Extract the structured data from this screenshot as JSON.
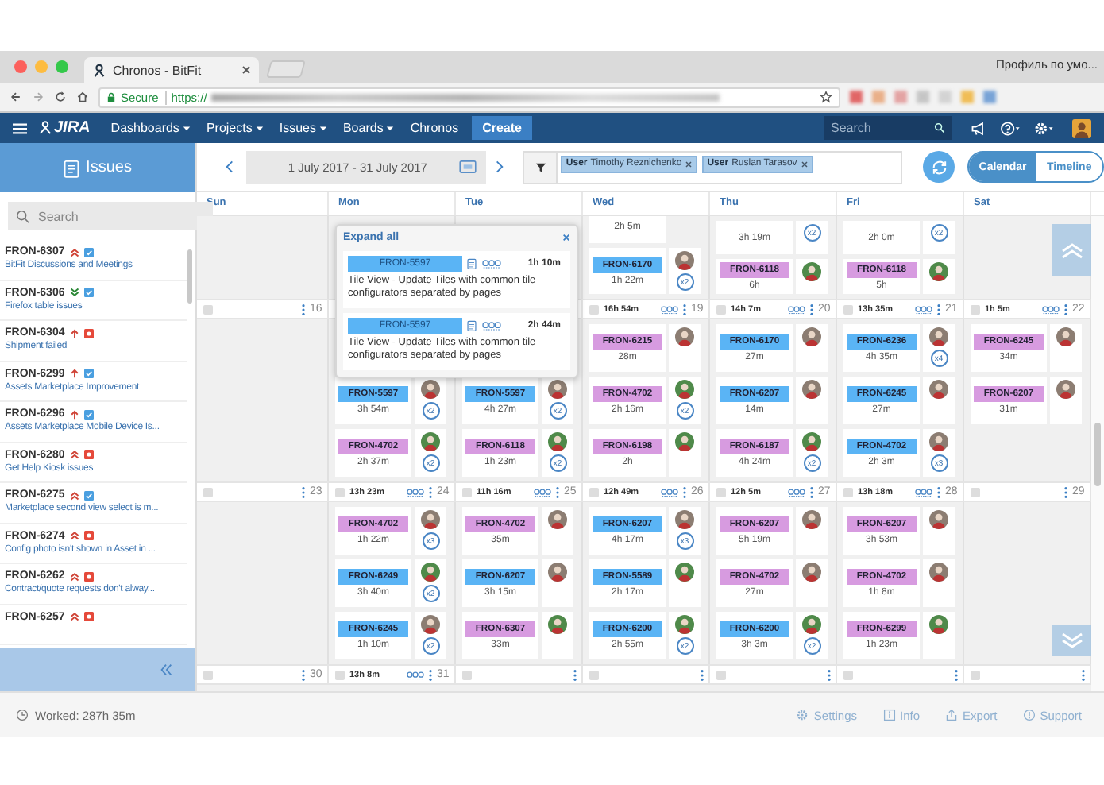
{
  "browser": {
    "tab_title": "Chronos - BitFit",
    "profile": "Профиль по умо...",
    "secure_label": "Secure",
    "url_scheme": "https://"
  },
  "nav": {
    "logo": "JIRA",
    "menu": [
      {
        "label": "Dashboards",
        "dropdown": true
      },
      {
        "label": "Projects",
        "dropdown": true
      },
      {
        "label": "Issues",
        "dropdown": true
      },
      {
        "label": "Boards",
        "dropdown": true
      },
      {
        "label": "Chronos",
        "dropdown": false
      }
    ],
    "create": "Create",
    "search": {
      "placeholder": "Search"
    }
  },
  "sidebar": {
    "title": "Issues",
    "search": {
      "placeholder": "Search"
    },
    "issues": [
      {
        "key": "FRON-6307",
        "icons": [
          {
            "kind": "highest"
          },
          {
            "kind": "task"
          }
        ],
        "title": "BitFit Discussions and Meetings"
      },
      {
        "key": "FRON-6306",
        "icons": [
          {
            "kind": "lowest"
          },
          {
            "kind": "task"
          }
        ],
        "title": "Firefox table issues"
      },
      {
        "key": "FRON-6304",
        "icons": [
          {
            "kind": "high"
          },
          {
            "kind": "bug"
          }
        ],
        "title": "Shipment failed"
      },
      {
        "key": "FRON-6299",
        "icons": [
          {
            "kind": "high"
          },
          {
            "kind": "task"
          }
        ],
        "title": "Assets Marketplace Improvement"
      },
      {
        "key": "FRON-6296",
        "icons": [
          {
            "kind": "high"
          },
          {
            "kind": "task"
          }
        ],
        "title": "Assets Marketplace Mobile Device Is..."
      },
      {
        "key": "FRON-6280",
        "icons": [
          {
            "kind": "highest"
          },
          {
            "kind": "bug"
          }
        ],
        "title": "Get Help Kiosk issues"
      },
      {
        "key": "FRON-6275",
        "icons": [
          {
            "kind": "highest"
          },
          {
            "kind": "task"
          }
        ],
        "title": "Marketplace second view select is m..."
      },
      {
        "key": "FRON-6274",
        "icons": [
          {
            "kind": "highest"
          },
          {
            "kind": "bug"
          }
        ],
        "title": "Config photo isn't shown in Asset in ..."
      },
      {
        "key": "FRON-6262",
        "icons": [
          {
            "kind": "highest"
          },
          {
            "kind": "bug"
          }
        ],
        "title": "Contract/quote requests don't alway..."
      },
      {
        "key": "FRON-6257",
        "icons": [
          {
            "kind": "highest"
          },
          {
            "kind": "bug"
          }
        ]
      }
    ]
  },
  "toolbar": {
    "range": "1 July 2017 - 31 July 2017",
    "filters": [
      {
        "label": "User",
        "value": "Timothy Reznichenko"
      },
      {
        "label": "User",
        "value": "Ruslan Tarasov"
      }
    ],
    "views": [
      {
        "label": "Calendar",
        "selected": true
      },
      {
        "label": "Timeline",
        "selected": false
      }
    ]
  },
  "weekdays": [
    "Sun",
    "Mon",
    "Tue",
    "Wed",
    "Thu",
    "Fri",
    "Sat"
  ],
  "rows": [
    {
      "kind": "partial",
      "cells": [
        {},
        {},
        {},
        {
          "cards": [
            {
              "duration": "2h 5m"
            },
            {
              "ticket": "FRON-6170",
              "color": "#5ab4f5",
              "duration": "1h 22m",
              "badge": "x2",
              "avatar": {
                "color": "#8c7d72"
              }
            }
          ]
        },
        {
          "cards": [
            {
              "duration": "3h 19m",
              "badge": "x2"
            },
            {
              "ticket": "FRON-6118",
              "color": "#d79be0",
              "duration": "6h",
              "avatar": {
                "color": "#4f8a4a"
              }
            }
          ]
        },
        {
          "cards": [
            {
              "duration": "2h 0m",
              "badge": "x2"
            },
            {
              "ticket": "FRON-6118",
              "color": "#d79be0",
              "duration": "5h",
              "avatar": {
                "color": "#4f8a4a"
              }
            }
          ]
        },
        {}
      ]
    },
    {
      "kind": "header",
      "cells": [
        {
          "checked": false,
          "number": "16"
        },
        {},
        {},
        {
          "checked": false,
          "total": "16h 54m",
          "linked": true,
          "number": "19"
        },
        {
          "checked": false,
          "total": "14h 7m",
          "linked": true,
          "number": "20"
        },
        {
          "checked": false,
          "total": "13h 35m",
          "linked": true,
          "number": "21"
        },
        {
          "checked": false,
          "total": "1h 5m",
          "linked": true,
          "number": "22"
        }
      ]
    },
    {
      "kind": "cards",
      "cells": [
        {},
        {
          "scrolled": true,
          "cards": [
            {
              "ticket": "FRON-5597",
              "color": "#5ab4f5",
              "duration": "3h 54m",
              "badge": "x2",
              "avatar": {
                "color": "#8c7d72"
              }
            },
            {
              "ticket": "FRON-4702",
              "color": "#d79be0",
              "duration": "2h 37m",
              "badge": "x2",
              "avatar": {
                "color": "#4f8a4a"
              }
            }
          ]
        },
        {
          "scrolled": true,
          "cards": [
            {
              "ticket": "FRON-5597",
              "color": "#5ab4f5",
              "duration": "4h 27m",
              "badge": "x2",
              "avatar": {
                "color": "#8c7d72"
              }
            },
            {
              "ticket": "FRON-6118",
              "color": "#d79be0",
              "duration": "1h 23m",
              "badge": "x2",
              "avatar": {
                "color": "#4f8a4a"
              }
            }
          ]
        },
        {
          "cards": [
            {
              "ticket": "FRON-6215",
              "color": "#d79be0",
              "duration": "28m",
              "avatar": {
                "color": "#8c7d72"
              }
            },
            {
              "ticket": "FRON-4702",
              "color": "#d79be0",
              "duration": "2h 16m",
              "badge": "x2",
              "avatar": {
                "color": "#4f8a4a"
              }
            },
            {
              "ticket": "FRON-6198",
              "color": "#d79be0",
              "duration": "2h",
              "avatar": {
                "color": "#4f8a4a"
              }
            }
          ]
        },
        {
          "cards": [
            {
              "ticket": "FRON-6170",
              "color": "#5ab4f5",
              "duration": "27m",
              "avatar": {
                "color": "#8c7d72"
              }
            },
            {
              "ticket": "FRON-6207",
              "color": "#5ab4f5",
              "duration": "14m",
              "avatar": {
                "color": "#8c7d72"
              }
            },
            {
              "ticket": "FRON-6187",
              "color": "#d79be0",
              "duration": "4h 24m",
              "badge": "x2",
              "avatar": {
                "color": "#4f8a4a"
              }
            }
          ]
        },
        {
          "cards": [
            {
              "ticket": "FRON-6236",
              "color": "#5ab4f5",
              "duration": "4h 35m",
              "badge": "x4",
              "avatar": {
                "color": "#8c7d72"
              }
            },
            {
              "ticket": "FRON-6245",
              "color": "#5ab4f5",
              "duration": "27m",
              "avatar": {
                "color": "#8c7d72"
              }
            },
            {
              "ticket": "FRON-4702",
              "color": "#5ab4f5",
              "duration": "2h 3m",
              "badge": "x3",
              "avatar": {
                "color": "#8c7d72"
              }
            }
          ]
        },
        {
          "cards": [
            {
              "ticket": "FRON-6245",
              "color": "#d79be0",
              "duration": "34m",
              "avatar": {
                "color": "#8c7d72"
              }
            },
            {
              "ticket": "FRON-6207",
              "color": "#d79be0",
              "duration": "31m",
              "avatar": {
                "color": "#8c7d72"
              }
            }
          ]
        }
      ]
    },
    {
      "kind": "header",
      "cells": [
        {
          "checked": false,
          "number": "23"
        },
        {
          "checked": false,
          "total": "13h 23m",
          "linked": true,
          "number": "24"
        },
        {
          "checked": false,
          "total": "11h 16m",
          "linked": true,
          "number": "25"
        },
        {
          "checked": false,
          "total": "12h 49m",
          "linked": true,
          "number": "26"
        },
        {
          "checked": false,
          "total": "12h 5m",
          "linked": true,
          "number": "27"
        },
        {
          "checked": false,
          "total": "13h 18m",
          "linked": true,
          "number": "28"
        },
        {
          "checked": false,
          "number": "29"
        }
      ]
    },
    {
      "kind": "cards",
      "cells": [
        {},
        {
          "cards": [
            {
              "ticket": "FRON-4702",
              "color": "#d79be0",
              "duration": "1h 22m",
              "badge": "x3",
              "avatar": {
                "color": "#8c7d72"
              }
            },
            {
              "ticket": "FRON-6249",
              "color": "#5ab4f5",
              "duration": "3h 40m",
              "badge": "x2",
              "avatar": {
                "color": "#4f8a4a"
              }
            },
            {
              "ticket": "FRON-6245",
              "color": "#5ab4f5",
              "duration": "1h 10m",
              "badge": "x2",
              "avatar": {
                "color": "#8c7d72"
              }
            }
          ]
        },
        {
          "cards": [
            {
              "ticket": "FRON-4702",
              "color": "#d79be0",
              "duration": "35m",
              "avatar": {
                "color": "#8c7d72"
              }
            },
            {
              "ticket": "FRON-6207",
              "color": "#5ab4f5",
              "duration": "3h 15m",
              "avatar": {
                "color": "#8c7d72"
              }
            },
            {
              "ticket": "FRON-6307",
              "color": "#d79be0",
              "duration": "33m",
              "avatar": {
                "color": "#4f8a4a"
              }
            }
          ]
        },
        {
          "cards": [
            {
              "ticket": "FRON-6207",
              "color": "#5ab4f5",
              "duration": "4h 17m",
              "badge": "x3",
              "avatar": {
                "color": "#8c7d72"
              }
            },
            {
              "ticket": "FRON-5589",
              "color": "#5ab4f5",
              "duration": "2h 17m",
              "avatar": {
                "color": "#4f8a4a"
              }
            },
            {
              "ticket": "FRON-6200",
              "color": "#5ab4f5",
              "duration": "2h 55m",
              "badge": "x2",
              "avatar": {
                "color": "#4f8a4a"
              }
            }
          ]
        },
        {
          "cards": [
            {
              "ticket": "FRON-6207",
              "color": "#d79be0",
              "duration": "5h 19m",
              "avatar": {
                "color": "#8c7d72"
              }
            },
            {
              "ticket": "FRON-4702",
              "color": "#d79be0",
              "duration": "27m",
              "avatar": {
                "color": "#8c7d72"
              }
            },
            {
              "ticket": "FRON-6200",
              "color": "#5ab4f5",
              "duration": "3h 3m",
              "badge": "x2",
              "avatar": {
                "color": "#4f8a4a"
              }
            }
          ]
        },
        {
          "cards": [
            {
              "ticket": "FRON-6207",
              "color": "#d79be0",
              "duration": "3h 53m",
              "avatar": {
                "color": "#8c7d72"
              }
            },
            {
              "ticket": "FRON-4702",
              "color": "#d79be0",
              "duration": "1h 8m",
              "avatar": {
                "color": "#8c7d72"
              }
            },
            {
              "ticket": "FRON-6299",
              "color": "#d79be0",
              "duration": "1h 23m",
              "avatar": {
                "color": "#4f8a4a"
              }
            }
          ]
        },
        {}
      ]
    },
    {
      "kind": "header",
      "cells": [
        {
          "checked": false,
          "number": "30"
        },
        {
          "checked": false,
          "total": "13h 8m",
          "linked": true,
          "number": "31"
        },
        {
          "checked": false
        },
        {
          "checked": false
        },
        {
          "checked": false
        },
        {
          "checked": false
        },
        {
          "checked": false
        }
      ]
    }
  ],
  "popup": {
    "action": "Expand all",
    "entries": [
      {
        "ticket": "FRON-5597",
        "time": "1h 10m",
        "text": "Tile View - Update Tiles with common tile configurators separated by pages"
      },
      {
        "ticket": "FRON-5597",
        "time": "2h 44m",
        "text": "Tile View - Update Tiles with common tile configurators separated by pages"
      }
    ]
  },
  "footer": {
    "worked": "Worked: 287h 35m",
    "links": [
      {
        "kind": "settings",
        "label": "Settings"
      },
      {
        "kind": "info",
        "label": "Info"
      },
      {
        "kind": "export",
        "label": "Export"
      },
      {
        "kind": "support",
        "label": "Support"
      }
    ]
  }
}
